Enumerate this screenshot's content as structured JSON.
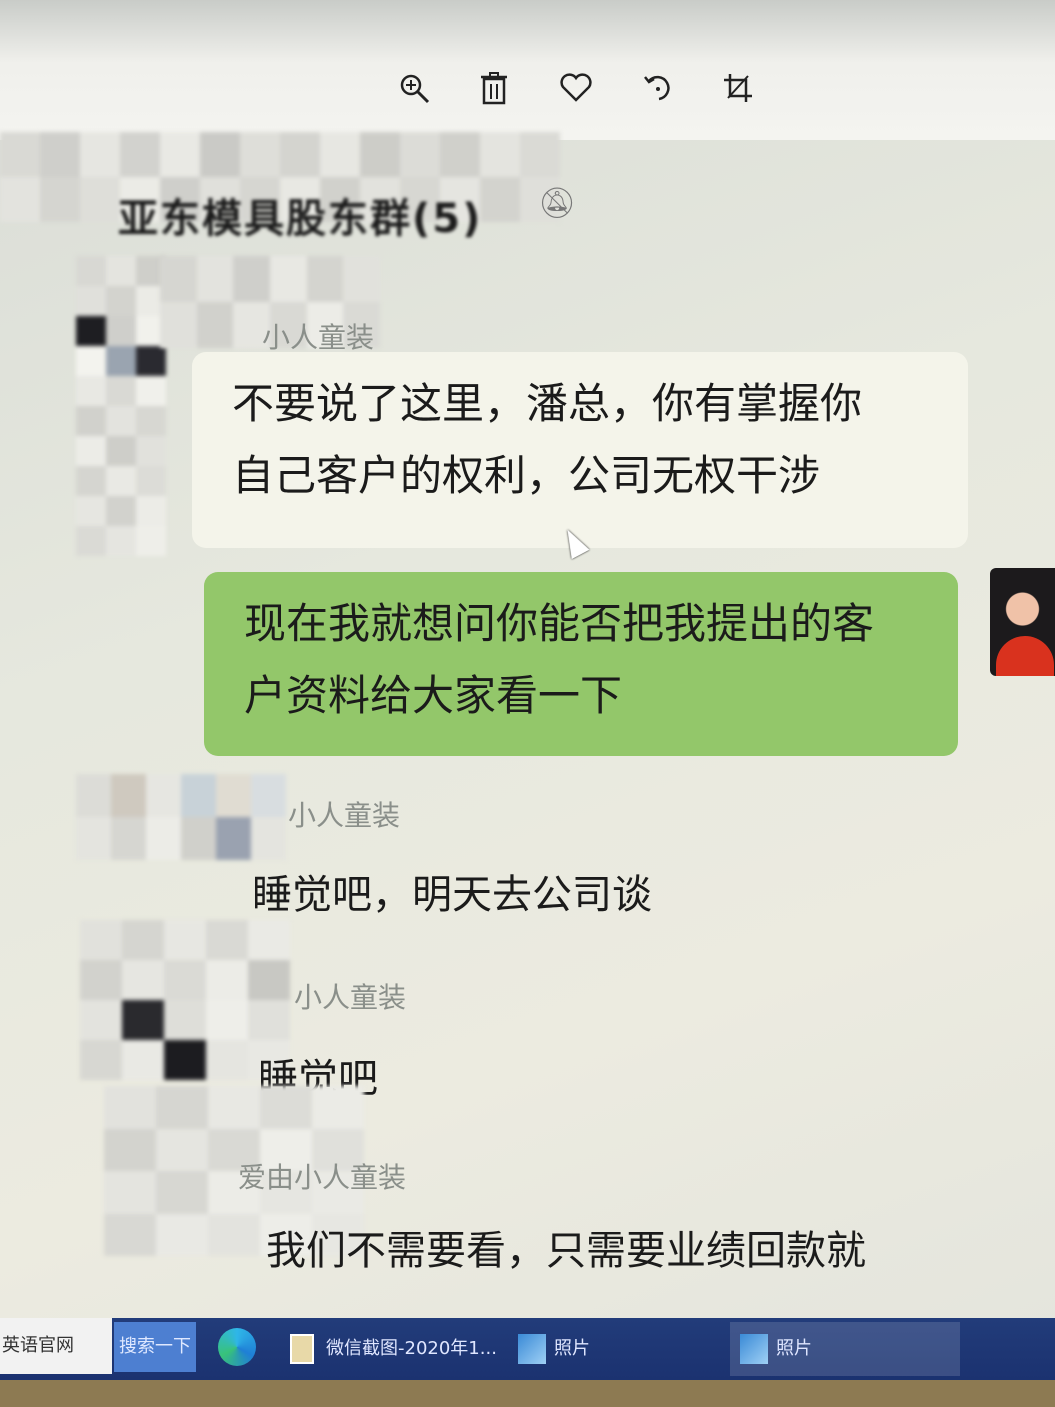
{
  "viewer_toolbar": {
    "zoom_icon": "magnifier-plus-icon",
    "delete_icon": "trash-icon",
    "favorite_icon": "heart-icon",
    "rotate_icon": "rotate-icon",
    "crop_icon": "crop-icon"
  },
  "chat": {
    "title": "亚东模具股东群(5)",
    "messages": [
      {
        "sender": "小人童装",
        "text": "不要说了这里，潘总，你有掌握你自己客户的权利，公司无权干涉",
        "line1": "不要说了这里，潘总，你有掌握你",
        "line2": "自己客户的权利，公司无权干涉"
      },
      {
        "self": true,
        "line1": "现在我就想问你能否把我提出的客",
        "line2": "户资料给大家看一下"
      },
      {
        "sender": "小人童装",
        "text": "睡觉吧，明天去公司谈"
      },
      {
        "sender": "小人童装",
        "text": "睡觉吧"
      },
      {
        "sender": "爱由小人童装",
        "text": "我们不需要看，只需要业绩回款就"
      }
    ]
  },
  "taskbar": {
    "search_text": "英语官网",
    "search_button": "搜索一下",
    "items": [
      {
        "label": "微信截图-2020年1..."
      },
      {
        "label": "照片"
      },
      {
        "label": "照片"
      }
    ]
  },
  "colors": {
    "self_bubble": "#93c76a",
    "other_bubble": "#f4f4ea",
    "taskbar": "#1b3270"
  }
}
